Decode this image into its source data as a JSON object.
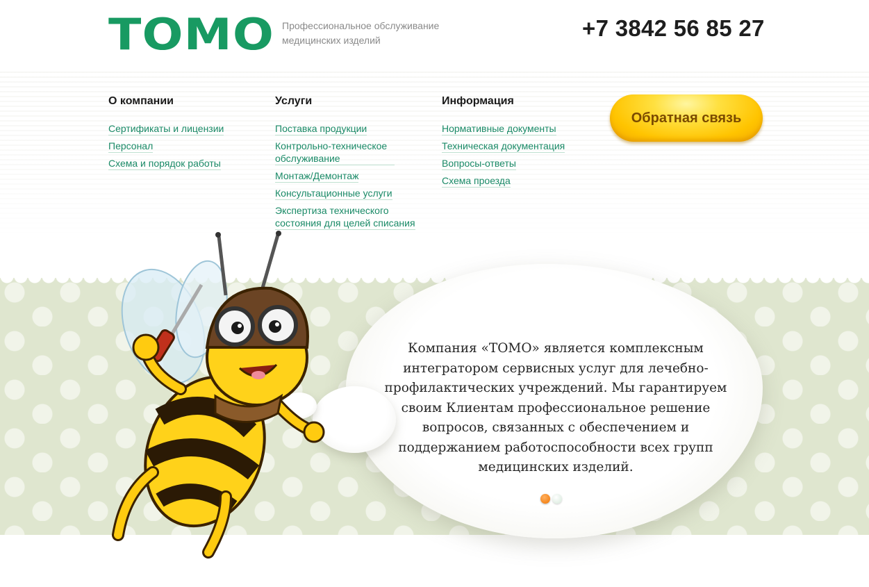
{
  "header": {
    "logo": "ТОМО",
    "tagline_line1": "Профессиональное обслуживание",
    "tagline_line2": "медицинских изделий",
    "phone": "+7 3842 56 85 27"
  },
  "nav": {
    "company": {
      "title": "О компании",
      "items": [
        "Сертификаты и лицензии",
        "Персонал",
        "Схема и порядок работы"
      ]
    },
    "services": {
      "title": "Услуги",
      "items": [
        "Поставка продукции",
        "Контрольно-техническое обслуживание",
        "Монтаж/Демонтаж",
        "Консультационные услуги",
        "Экспертиза технического состояния для целей списания"
      ]
    },
    "info": {
      "title": "Информация",
      "items": [
        "Нормативные документы",
        "Техническая документация",
        "Вопросы-ответы",
        "Схема проезда"
      ]
    }
  },
  "feedback_button": "Обратная связь",
  "hero": {
    "text": "Компания «ТОМО» является комплексным интегратором сервисных услуг для лечебно-профилактических учреждений. Мы гарантируем своим Клиентам профессиональное решение вопросов, связанных с обеспечением и поддержанием работоспособности всех групп медицинских изделий.",
    "slides_total": 2,
    "active_slide": 1
  },
  "colors": {
    "brand_green": "#189a62",
    "link": "#1a8a67",
    "button_yellow": "#ffc400",
    "active_dot": "#f07400"
  },
  "icons": {
    "mascot": "bee-mascot-icon"
  }
}
